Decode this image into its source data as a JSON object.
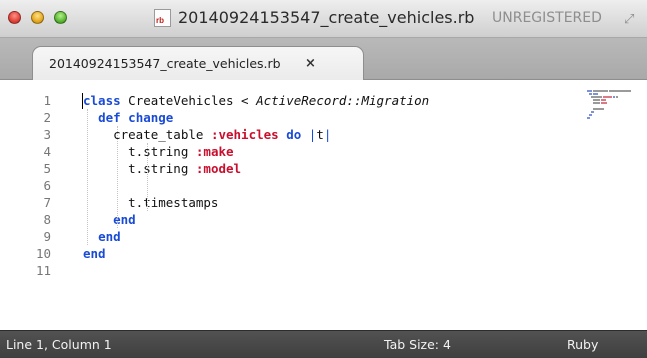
{
  "window": {
    "file_icon_text": "rb",
    "title": "20140924153547_create_vehicles.rb",
    "unregistered": "UNREGISTERED"
  },
  "tabs": [
    {
      "label": "20140924153547_create_vehicles.rb",
      "close": "×"
    }
  ],
  "editor": {
    "line_numbers": [
      "1",
      "2",
      "3",
      "4",
      "5",
      "6",
      "7",
      "8",
      "9",
      "10",
      "11"
    ],
    "code": [
      [
        {
          "t": "class",
          "c": "kw"
        },
        {
          "t": " CreateVehicles < ",
          "c": ""
        },
        {
          "t": "ActiveRecord::Migration",
          "c": "cls"
        }
      ],
      [
        {
          "t": "  ",
          "c": ""
        },
        {
          "t": "def",
          "c": "kw"
        },
        {
          "t": " ",
          "c": ""
        },
        {
          "t": "change",
          "c": "kw"
        }
      ],
      [
        {
          "t": "    create_table ",
          "c": ""
        },
        {
          "t": ":vehicles",
          "c": "sym"
        },
        {
          "t": " ",
          "c": ""
        },
        {
          "t": "do",
          "c": "kw"
        },
        {
          "t": " ",
          "c": ""
        },
        {
          "t": "|",
          "c": "pipe"
        },
        {
          "t": "t",
          "c": ""
        },
        {
          "t": "|",
          "c": "pipe"
        }
      ],
      [
        {
          "t": "      t.string ",
          "c": ""
        },
        {
          "t": ":make",
          "c": "sym"
        }
      ],
      [
        {
          "t": "      t.string ",
          "c": ""
        },
        {
          "t": ":model",
          "c": "sym"
        }
      ],
      [],
      [
        {
          "t": "      t.timestamps",
          "c": ""
        }
      ],
      [
        {
          "t": "    ",
          "c": ""
        },
        {
          "t": "end",
          "c": "kw"
        }
      ],
      [
        {
          "t": "  ",
          "c": ""
        },
        {
          "t": "end",
          "c": "kw"
        }
      ],
      [
        {
          "t": "end",
          "c": "kw"
        }
      ],
      []
    ]
  },
  "status": {
    "position": "Line 1, Column 1",
    "tab_size": "Tab Size: 4",
    "syntax": "Ruby"
  },
  "colors": {
    "keyword": "#1a4bd6",
    "symbol": "#c8102e",
    "status_bar": "#474747"
  }
}
